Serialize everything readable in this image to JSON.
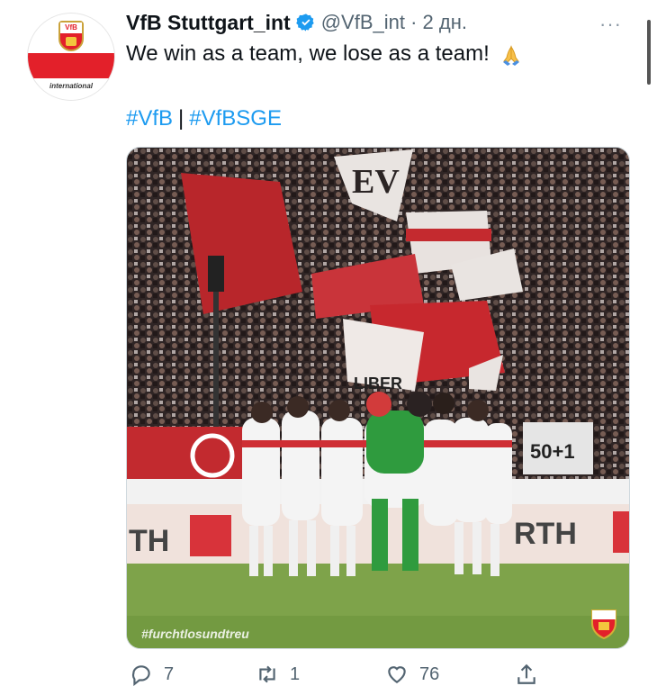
{
  "tweet": {
    "display_name": "VfB Stuttgart_int",
    "handle_time": "@VfB_int · 2 дн.",
    "text": "We win as a team, we lose as a team!",
    "hashtag_1": "#VfB",
    "separator": "|",
    "hashtag_2": "#VfBSGE",
    "more_label": "···"
  },
  "avatar": {
    "crest_text": "VfB",
    "sub_text": "international"
  },
  "media": {
    "caption": "#furchtlosundtreu",
    "banner_left": "TH",
    "banner_right": "RTH",
    "flag_text": "LIBER",
    "sign_text": "50+1"
  },
  "actions": {
    "reply_count": "7",
    "retweet_count": "1",
    "like_count": "76"
  },
  "colors": {
    "accent": "#1d9bf0",
    "brand_red": "#e3202a",
    "text": "#0f1419",
    "muted": "#536471"
  },
  "icons": [
    "reply-icon",
    "retweet-icon",
    "like-icon",
    "share-icon",
    "verified-icon",
    "more-icon",
    "folded-hands-emoji"
  ]
}
